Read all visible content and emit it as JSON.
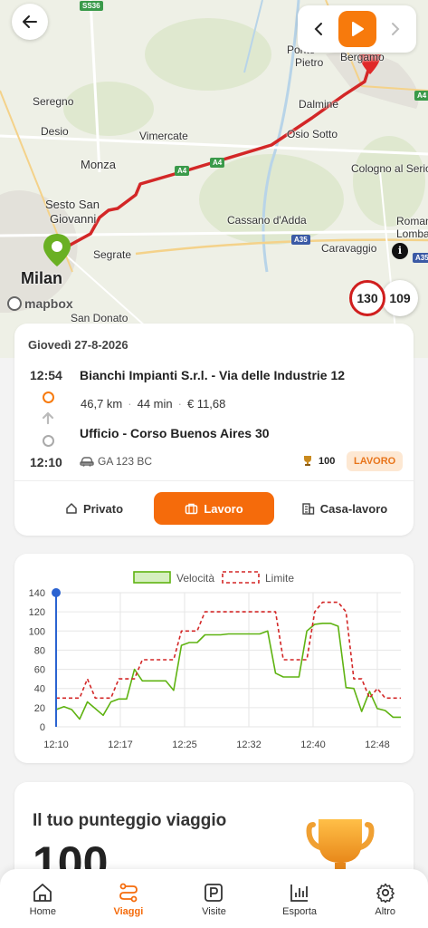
{
  "map": {
    "labels": {
      "milan": "Milan",
      "monza": "Monza",
      "sesto": "Sesto San",
      "giovanni": "Giovanni",
      "segrate": "Segrate",
      "san_donato": "San Donato",
      "vimercate": "Vimercate",
      "cassano": "Cassano d'Adda",
      "caravaggio": "Caravaggio",
      "cologno": "Cologno al Serio",
      "dalmine": "Dalmine",
      "osio": "Osio Sotto",
      "ponte": "Ponte",
      "pietro": "Pietro",
      "bergamo": "Bergamo",
      "seregno": "Seregno",
      "desio": "Desio",
      "romano": "Romano",
      "lomba": "Lomba",
      "ss36": "SS36",
      "a4": "A4",
      "a4b": "A4",
      "a4c": "A4",
      "a35a": "A35",
      "a35b": "A35"
    },
    "attribution": "mapbox",
    "speed_limit": "130",
    "current_speed": "109",
    "colors": {
      "route": "#d32727",
      "start_pin": "#6ab023",
      "end_pin": "#e02828"
    }
  },
  "trip": {
    "date": "Giovedì 27-8-2026",
    "start_time": "12:54",
    "start_address": "Bianchi Impianti S.r.l. - Via delle Industrie 12",
    "distance": "46,7 km",
    "duration": "44 min",
    "cost": "€ 11,68",
    "end_time": "12:10",
    "end_address": "Ufficio - Corso Buenos Aires 30",
    "plate": "GA 123 BC",
    "score": "100",
    "category_tag": "LAVORO",
    "categories": [
      "Privato",
      "Lavoro",
      "Casa-lavoro"
    ],
    "active_category": "Lavoro"
  },
  "chart_data": {
    "type": "line",
    "legend": [
      "Velocità",
      "Limite"
    ],
    "x_ticks": [
      "12:10",
      "12:17",
      "12:25",
      "12:32",
      "12:40",
      "12:48"
    ],
    "y_ticks": [
      "0",
      "20",
      "40",
      "60",
      "80",
      "100",
      "120",
      "140"
    ],
    "ylim": [
      0,
      140
    ],
    "x_range_minutes": [
      0,
      44
    ],
    "series": [
      {
        "name": "Velocità",
        "color": "#5fb312",
        "points": [
          [
            0,
            18
          ],
          [
            1,
            21
          ],
          [
            2,
            18
          ],
          [
            3,
            8
          ],
          [
            4,
            26
          ],
          [
            5,
            19
          ],
          [
            6,
            12
          ],
          [
            7,
            26
          ],
          [
            8,
            29
          ],
          [
            9,
            29
          ],
          [
            10,
            60
          ],
          [
            11,
            48
          ],
          [
            12,
            48
          ],
          [
            13,
            48
          ],
          [
            14,
            48
          ],
          [
            15,
            38
          ],
          [
            16,
            85
          ],
          [
            17,
            88
          ],
          [
            18,
            88
          ],
          [
            19,
            96
          ],
          [
            20,
            96
          ],
          [
            21,
            96
          ],
          [
            22,
            97
          ],
          [
            23,
            97
          ],
          [
            24,
            97
          ],
          [
            25,
            97
          ],
          [
            26,
            97
          ],
          [
            27,
            100
          ],
          [
            28,
            56
          ],
          [
            29,
            52
          ],
          [
            30,
            52
          ],
          [
            31,
            52
          ],
          [
            32,
            100
          ],
          [
            33,
            107
          ],
          [
            34,
            108
          ],
          [
            35,
            108
          ],
          [
            36,
            105
          ],
          [
            37,
            41
          ],
          [
            38,
            40
          ],
          [
            39,
            16
          ],
          [
            40,
            37
          ],
          [
            41,
            19
          ],
          [
            42,
            17
          ],
          [
            43,
            10
          ],
          [
            44,
            10
          ]
        ]
      },
      {
        "name": "Limite",
        "color": "#d32727",
        "points": [
          [
            0,
            30
          ],
          [
            3,
            30
          ],
          [
            4,
            50
          ],
          [
            5,
            30
          ],
          [
            7,
            30
          ],
          [
            8,
            50
          ],
          [
            10,
            50
          ],
          [
            11,
            70
          ],
          [
            15,
            70
          ],
          [
            16,
            100
          ],
          [
            18,
            100
          ],
          [
            19,
            120
          ],
          [
            28,
            120
          ],
          [
            29,
            70
          ],
          [
            32,
            70
          ],
          [
            33,
            120
          ],
          [
            34,
            130
          ],
          [
            36,
            130
          ],
          [
            37,
            120
          ],
          [
            38,
            50
          ],
          [
            39,
            50
          ],
          [
            40,
            30
          ],
          [
            41,
            40
          ],
          [
            42,
            30
          ],
          [
            44,
            30
          ]
        ]
      }
    ]
  },
  "score_card": {
    "title": "Il tuo punteggio viaggio",
    "value": "100"
  },
  "bottom_nav": {
    "items": [
      "Home",
      "Viaggi",
      "Visite",
      "Esporta",
      "Altro"
    ],
    "active": "Viaggi"
  }
}
